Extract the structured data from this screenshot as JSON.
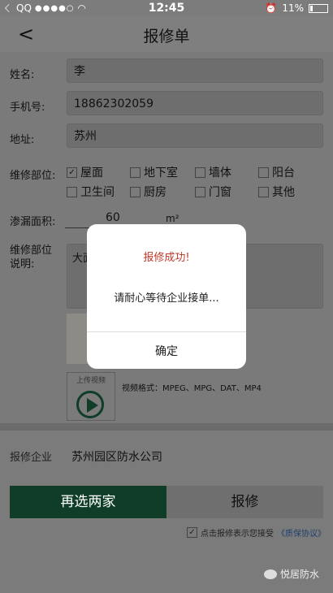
{
  "status": {
    "carrier": "QQ",
    "signal": "●●●●○",
    "time": "12:45",
    "battery": "11%"
  },
  "nav": {
    "back": "<",
    "title": "报修单"
  },
  "form": {
    "name_label": "姓名:",
    "name_value": "李",
    "phone_label": "手机号:",
    "phone_value": "18862302059",
    "address_label": "地址:",
    "address_value": "苏州",
    "part_label": "维修部位:",
    "parts": [
      {
        "label": "屋面",
        "checked": true
      },
      {
        "label": "地下室",
        "checked": false
      },
      {
        "label": "墙体",
        "checked": false
      },
      {
        "label": "阳台",
        "checked": false
      },
      {
        "label": "卫生间",
        "checked": false
      },
      {
        "label": "厨房",
        "checked": false
      },
      {
        "label": "门窗",
        "checked": false
      },
      {
        "label": "其他",
        "checked": false
      }
    ],
    "area_label": "渗漏面积:",
    "area_value": "60",
    "area_unit": "m²",
    "desc_label": "维修部位说明:",
    "desc_value": "大面",
    "upload_label": "上传视频",
    "video_formats": "视频格式：MPEG、MPG、DAT、MP4"
  },
  "company": {
    "label": "报修企业",
    "value": "苏州园区防水公司"
  },
  "actions": {
    "reselect": "再选两家",
    "submit": "报修"
  },
  "agreement": {
    "text": "点击报修表示您接受",
    "link": "《质保协议》"
  },
  "watermark": "悦居防水",
  "dialog": {
    "title": "报修成功!",
    "message": "请耐心等待企业接单...",
    "confirm": "确定"
  }
}
